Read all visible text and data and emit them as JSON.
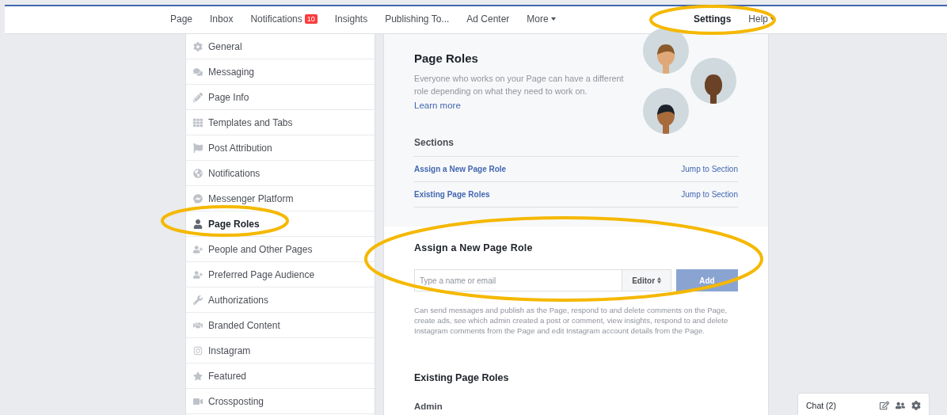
{
  "nav": {
    "items": [
      {
        "label": "Page",
        "selected": false
      },
      {
        "label": "Inbox",
        "selected": false
      },
      {
        "label": "Notifications",
        "badge": "10",
        "selected": false
      },
      {
        "label": "Insights",
        "selected": false
      },
      {
        "label": "Publishing To...",
        "selected": false
      },
      {
        "label": "Ad Center",
        "selected": false
      },
      {
        "label": "More",
        "caret": true,
        "selected": false
      }
    ],
    "right": [
      {
        "label": "Settings",
        "selected": true
      },
      {
        "label": "Help",
        "caret": true,
        "selected": false
      }
    ]
  },
  "sidebar": {
    "items": [
      {
        "label": "General",
        "selected": false
      },
      {
        "label": "Messaging",
        "selected": false
      },
      {
        "label": "Page Info",
        "selected": false
      },
      {
        "label": "Templates and Tabs",
        "selected": false
      },
      {
        "label": "Post Attribution",
        "selected": false
      },
      {
        "label": "Notifications",
        "selected": false
      },
      {
        "label": "Messenger Platform",
        "selected": false
      },
      {
        "label": "Page Roles",
        "selected": true
      },
      {
        "label": "People and Other Pages",
        "selected": false
      },
      {
        "label": "Preferred Page Audience",
        "selected": false
      },
      {
        "label": "Authorizations",
        "selected": false
      },
      {
        "label": "Branded Content",
        "selected": false
      },
      {
        "label": "Instagram",
        "selected": false
      },
      {
        "label": "Featured",
        "selected": false
      },
      {
        "label": "Crossposting",
        "selected": false
      }
    ]
  },
  "intro": {
    "title": "Page Roles",
    "description": "Everyone who works on your Page can have a different role depending on what they need to work on.",
    "link": "Learn more"
  },
  "sections": {
    "title": "Sections",
    "rows": [
      {
        "label": "Assign a New Page Role",
        "action": "Jump to Section"
      },
      {
        "label": "Existing Page Roles",
        "action": "Jump to Section"
      }
    ]
  },
  "assign": {
    "title": "Assign a New Page Role",
    "placeholder": "Type a name or email",
    "role": "Editor",
    "button": "Add",
    "description": "Can send messages and publish as the Page, respond to and delete comments on the Page, create ads, see which admin created a post or comment, view insights, respond to and delete Instagram comments from the Page and edit Instagram account details from the Page."
  },
  "existing": {
    "title": "Existing Page Roles",
    "role": "Admin"
  },
  "chat": {
    "label": "Chat (2)"
  }
}
